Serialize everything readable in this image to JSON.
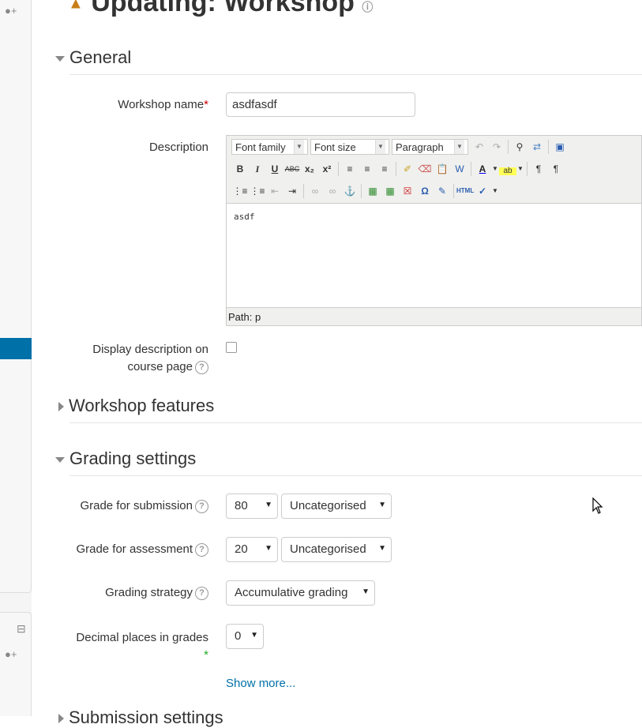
{
  "page": {
    "title": "Updating: Workshop"
  },
  "sections": {
    "general": "General",
    "features": "Workshop features",
    "grading": "Grading settings",
    "submission": "Submission settings"
  },
  "form": {
    "workshop_name_label": "Workshop name",
    "workshop_name_required": "*",
    "workshop_name_value": "asdfasdf",
    "description_label": "Description",
    "editor": {
      "font_family": "Font family",
      "font_size": "Font size",
      "format": "Paragraph",
      "content": "asdf",
      "path": "Path: p"
    },
    "display_desc_label_1": "Display description on",
    "display_desc_label_2": "course page",
    "grade_submission_label": "Grade for submission",
    "grade_submission_value": "80",
    "grade_submission_category": "Uncategorised",
    "grade_assessment_label": "Grade for assessment",
    "grade_assessment_value": "20",
    "grade_assessment_category": "Uncategorised",
    "grading_strategy_label": "Grading strategy",
    "grading_strategy_value": "Accumulative grading",
    "decimal_places_label": "Decimal places in grades",
    "decimal_places_value": "0",
    "decimal_places_marker": "*",
    "show_more": "Show more..."
  },
  "icons": {
    "help": "?",
    "accent": "#0070a8"
  }
}
